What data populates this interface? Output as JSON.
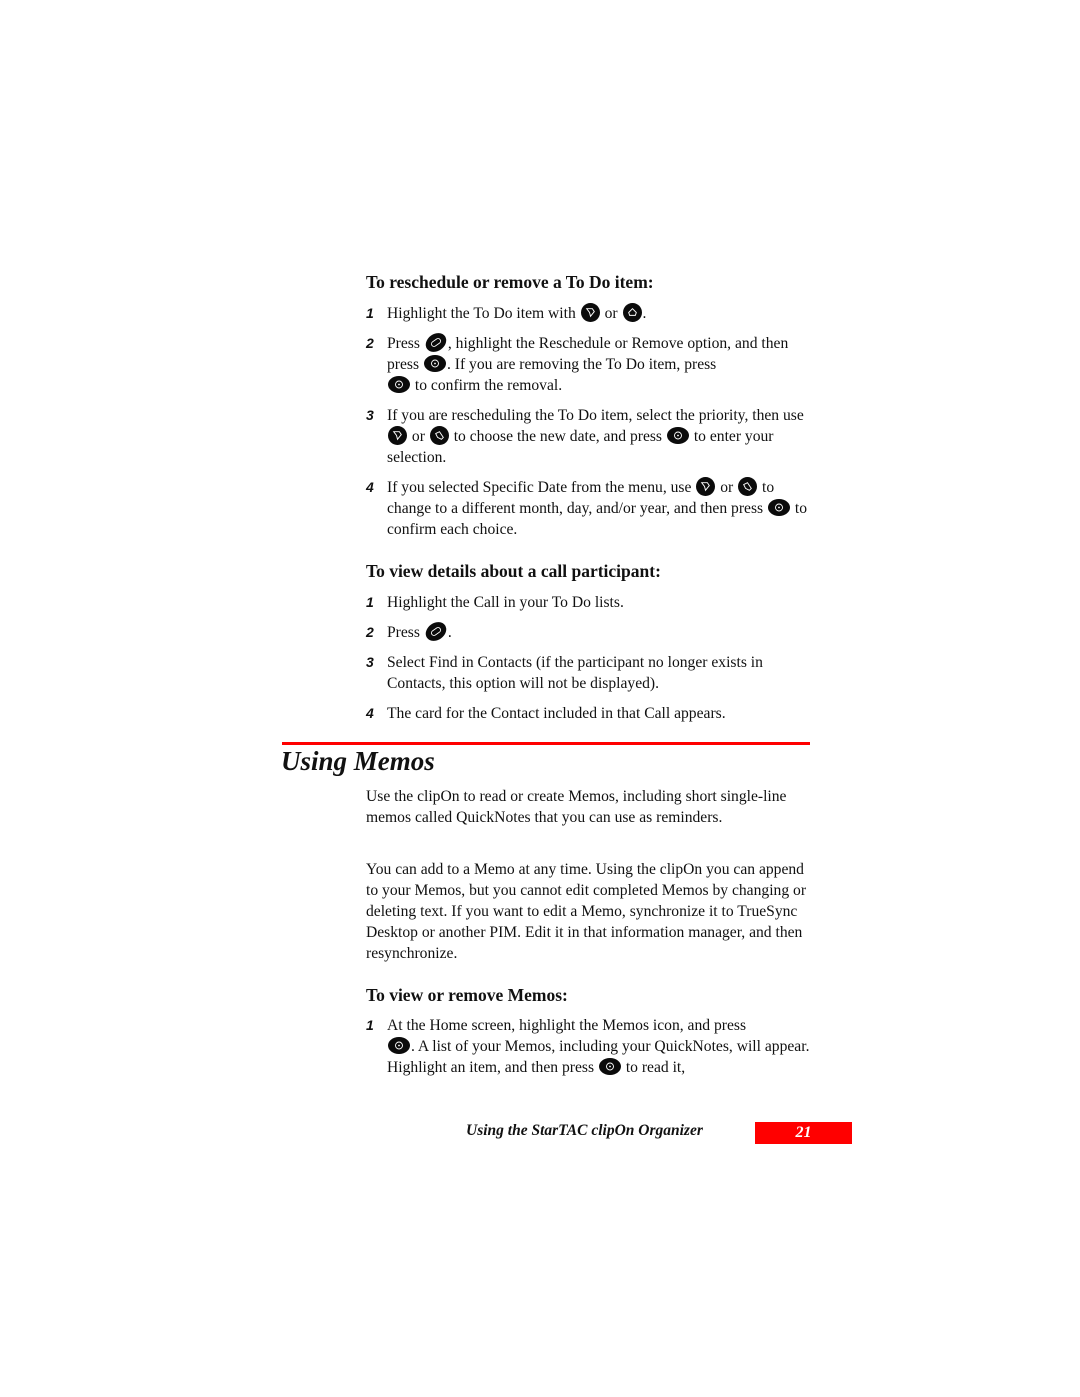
{
  "colors": {
    "accent_red": "#ff0000",
    "text": "#111111",
    "key_fill": "#0b0b0b"
  },
  "reschedule": {
    "heading": "To reschedule or remove a To Do item:",
    "steps": [
      {
        "num": "1",
        "parts": [
          "Highlight the To Do item with",
          "or",
          "."
        ]
      },
      {
        "num": "2",
        "parts": [
          "Press",
          ", highlight the Reschedule or Remove option, and then press",
          ". If you are removing the To Do item, press",
          "to confirm the removal."
        ]
      },
      {
        "num": "3",
        "parts": [
          "If you are rescheduling the To Do item, select the priority, then use",
          "or",
          "to choose the new date, and press",
          "to enter your selection."
        ]
      },
      {
        "num": "4",
        "parts": [
          "If you selected Specific Date from the menu, use",
          "or",
          "to change to a different month, day, and/or year, and then press",
          "to confirm each choice."
        ]
      }
    ]
  },
  "call_participant": {
    "heading": "To view details about a call participant:",
    "steps": [
      {
        "num": "1",
        "text": "Highlight the Call in your To Do lists."
      },
      {
        "num": "2",
        "parts": [
          "Press",
          "."
        ]
      },
      {
        "num": "3",
        "text": "Select Find in Contacts (if the participant no longer exists in Contacts, this option will not be displayed)."
      },
      {
        "num": "4",
        "text": "The card for the Contact included in that Call appears."
      }
    ]
  },
  "memos": {
    "title": "Using Memos",
    "paragraphs": [
      "Use the clipOn to read or create Memos, including short single-line memos called QuickNotes that you can use as reminders.",
      "You can add to a Memo at any time. Using the clipOn you can append to your Memos, but you cannot edit completed Memos by changing or deleting text. If you want to edit a Memo, synchronize it to TrueSync Desktop or another PIM. Edit it in that information manager, and then resynchronize."
    ],
    "view_remove": {
      "heading": "To view or remove Memos:",
      "steps": [
        {
          "num": "1",
          "parts": [
            "At the Home screen, highlight the Memos icon, and press",
            ". A list of your Memos, including your QuickNotes, will appear. Highlight an item, and then press",
            "to read it,"
          ]
        }
      ]
    }
  },
  "footer": {
    "title": "Using the StarTAC clipOn Organizer",
    "page_number": "21"
  },
  "icons": {
    "scroll_up": "scroll-up-key",
    "scroll_down": "scroll-down-key",
    "menu": "menu-key",
    "select": "select-key"
  }
}
